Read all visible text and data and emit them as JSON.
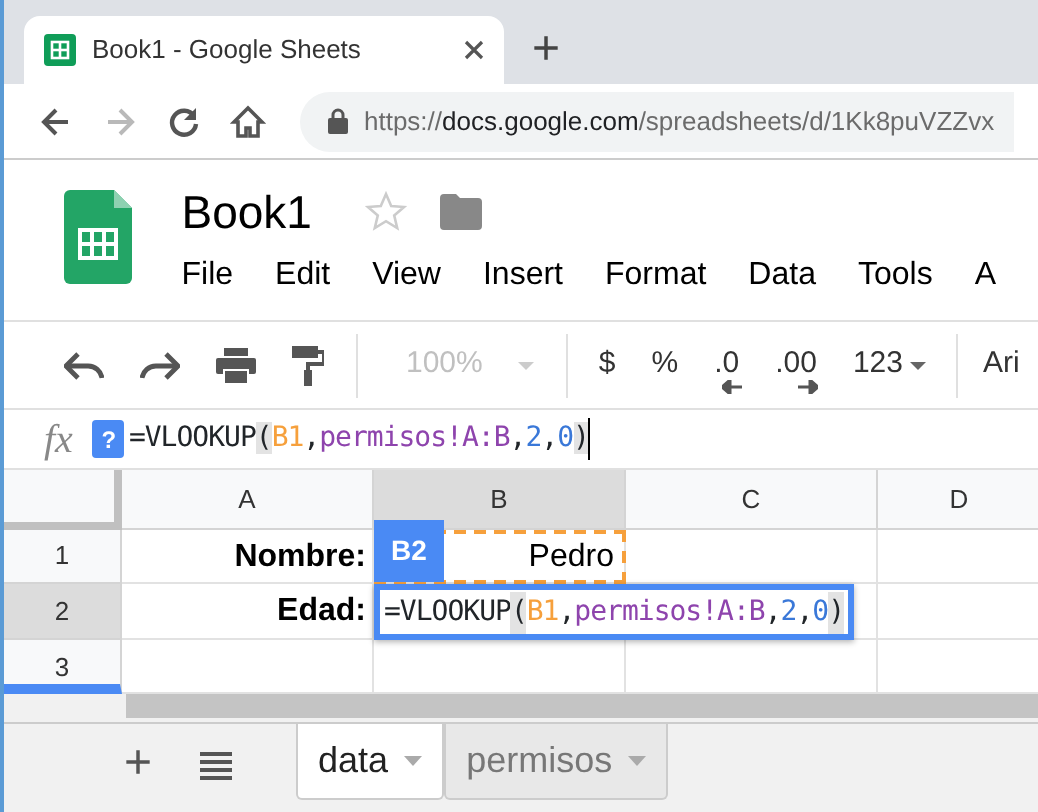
{
  "browser": {
    "tab": {
      "title": "Book1 - Google Sheets",
      "selected": true
    },
    "new_tab": "+",
    "nav": [
      {
        "kind": "back",
        "disabled": false
      },
      {
        "kind": "forward",
        "disabled": true
      },
      {
        "kind": "reload",
        "disabled": false
      },
      {
        "kind": "home",
        "disabled": false
      }
    ],
    "url": {
      "scheme": "https://",
      "host": "docs.google.com",
      "path": "/spreadsheets/d/1Kk8puVZZvx"
    }
  },
  "doc": {
    "title": "Book1",
    "starred": false,
    "menu": [
      "File",
      "Edit",
      "View",
      "Insert",
      "Format",
      "Data",
      "Tools",
      "A"
    ]
  },
  "toolbar": {
    "zoom": {
      "label": "100%",
      "disabled": true
    },
    "formats": [
      {
        "label": "$",
        "kind": "plain"
      },
      {
        "label": "%",
        "kind": "plain"
      },
      {
        "label": ".0",
        "kind": "decrease"
      },
      {
        "label": ".00",
        "kind": "increase"
      },
      {
        "label": "123",
        "kind": "dropdown"
      }
    ],
    "font": "Ari"
  },
  "formula_bar": {
    "fx": "fx",
    "help": "?",
    "tokens": [
      {
        "text": "=VLOOKUP",
        "kind": "text"
      },
      {
        "text": "(",
        "kind": "paren"
      },
      {
        "text": "B1",
        "kind": "ref"
      },
      {
        "text": ",",
        "kind": "text"
      },
      {
        "text": "permisos!A:B",
        "kind": "range"
      },
      {
        "text": ",",
        "kind": "text"
      },
      {
        "text": "2",
        "kind": "number"
      },
      {
        "text": ",",
        "kind": "text"
      },
      {
        "text": "0",
        "kind": "number"
      },
      {
        "text": ")",
        "kind": "paren"
      }
    ]
  },
  "grid": {
    "columns": [
      {
        "label": "A",
        "selected": false
      },
      {
        "label": "B",
        "selected": true
      },
      {
        "label": "C",
        "selected": false
      },
      {
        "label": "D",
        "selected": false
      }
    ],
    "rows": [
      {
        "label": "1",
        "selected": false,
        "cells": [
          {
            "text": "Nombre:",
            "bold": true
          },
          {
            "text": "Pedro",
            "bold": false,
            "highlighted": true
          },
          {
            "text": ""
          },
          {
            "text": ""
          }
        ]
      },
      {
        "label": "2",
        "selected": true,
        "cells": [
          {
            "text": "Edad:",
            "bold": true
          },
          {
            "text": ""
          },
          {
            "text": ""
          },
          {
            "text": ""
          }
        ]
      },
      {
        "label": "3",
        "selected": false,
        "cells": [
          {
            "text": ""
          },
          {
            "text": ""
          },
          {
            "text": ""
          },
          {
            "text": ""
          }
        ]
      }
    ],
    "editor": {
      "cell": "B2",
      "tokens": [
        {
          "text": "=VLOOKUP",
          "kind": "text"
        },
        {
          "text": "(",
          "kind": "paren"
        },
        {
          "text": "B1",
          "kind": "ref"
        },
        {
          "text": ",",
          "kind": "text"
        },
        {
          "text": "permisos!A:B",
          "kind": "range"
        },
        {
          "text": ",",
          "kind": "text"
        },
        {
          "text": "2",
          "kind": "number"
        },
        {
          "text": ",",
          "kind": "text"
        },
        {
          "text": "0",
          "kind": "number"
        },
        {
          "text": ")",
          "kind": "paren"
        }
      ]
    }
  },
  "sheet_tabs": {
    "add": "+",
    "tabs": [
      {
        "label": "data",
        "selected": true
      },
      {
        "label": "permisos",
        "selected": false
      }
    ]
  }
}
